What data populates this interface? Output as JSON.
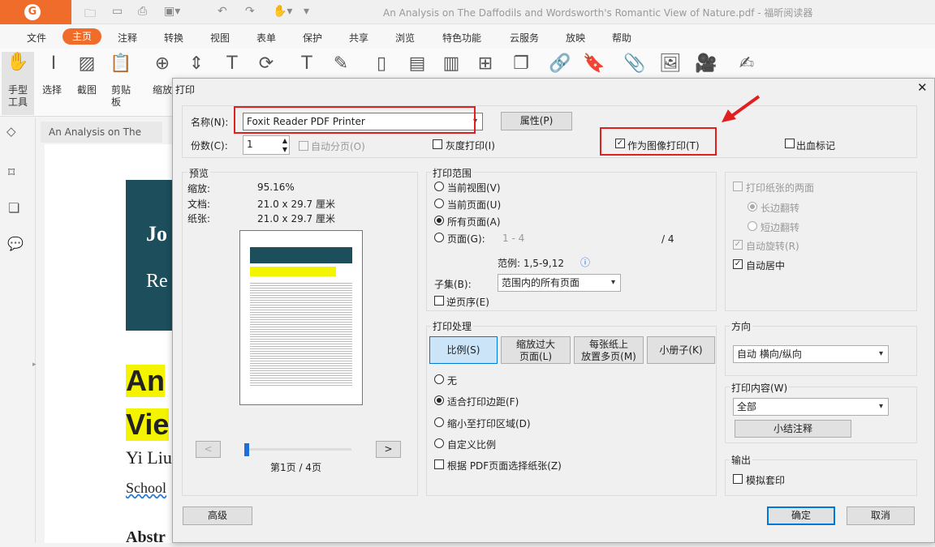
{
  "app": {
    "title": "An Analysis on The Daffodils and Wordsworth's Romantic View of Nature.pdf - 福昕阅读器",
    "logo": "G"
  },
  "menu": [
    "文件",
    "主页",
    "注释",
    "转换",
    "视图",
    "表单",
    "保护",
    "共享",
    "浏览",
    "特色功能",
    "云服务",
    "放映",
    "帮助"
  ],
  "ribbon": {
    "hand": "手型\n工具",
    "select": "选择",
    "screenshot": "截图",
    "clipboard": "剪贴\n板",
    "zoom": "缩放"
  },
  "doc": {
    "tab": "An Analysis on The Daf...",
    "banner_1": "Jo",
    "banner_2": "Re",
    "title_1": "An",
    "title_2": "Vie",
    "author": "Yi Liu",
    "school": "School",
    "abstract": "Abstr"
  },
  "dialog": {
    "title": "打印",
    "close": "✕",
    "printer_label": "名称(N):",
    "printer_value": "Foxit Reader PDF Printer",
    "props_btn": "属性(P)",
    "copies_label": "份数(C):",
    "copies_value": "1",
    "collate": "自动分页(O)",
    "grayscale": "灰度打印(I)",
    "as_image": "作为图像打印(T)",
    "bleed": "出血标记",
    "preview": {
      "title": "预览",
      "zoom_label": "缩放:",
      "zoom_value": "95.16%",
      "doc_label": "文档:",
      "doc_value": "21.0 x 29.7 厘米",
      "paper_label": "纸张:",
      "paper_value": "21.0 x 29.7 厘米",
      "prev": "<",
      "next": ">",
      "page_text": "第1页 / 4页"
    },
    "range": {
      "title": "打印范围",
      "current_view": "当前视图(V)",
      "current_page": "当前页面(U)",
      "all_pages": "所有页面(A)",
      "pages": "页面(G):",
      "pages_value": "1 - 4",
      "pages_total": "/ 4",
      "example": "范例: 1,5-9,12",
      "subset_label": "子集(B):",
      "subset_value": "范围内的所有页面",
      "reverse": "逆页序(E)"
    },
    "handling": {
      "title": "打印处理",
      "tab_scale": "比例(S)",
      "tab_tile": "缩放过大\n页面(L)",
      "tab_multi": "每张纸上\n放置多页(M)",
      "tab_booklet": "小册子(K)",
      "none": "无",
      "fit_margins": "适合打印边距(F)",
      "shrink": "缩小至打印区域(D)",
      "custom": "自定义比例",
      "by_pdf": "根据 PDF页面选择纸张(Z)"
    },
    "duplex": {
      "both_sides": "打印纸张的两面",
      "long_edge": "长边翻转",
      "short_edge": "短边翻转",
      "auto_rotate": "自动旋转(R)",
      "auto_center": "自动居中"
    },
    "orientation": {
      "title": "方向",
      "value": "自动 横向/纵向"
    },
    "content": {
      "title": "打印内容(W)",
      "value": "全部",
      "summarize": "小结注释"
    },
    "output": {
      "title": "输出",
      "simulate": "模拟套印"
    },
    "advanced": "高级",
    "ok": "确定",
    "cancel": "取消"
  },
  "colors": {
    "accent": "#ef6c2a",
    "highlight_box": "#e02020",
    "arrow": "#e02020"
  }
}
